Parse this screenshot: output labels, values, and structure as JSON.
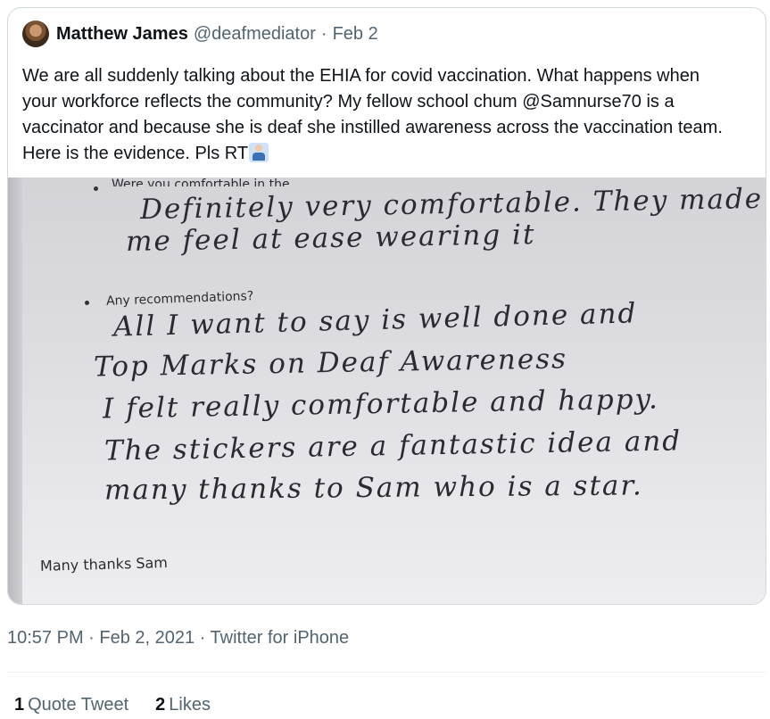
{
  "tweet": {
    "author_name": "Matthew James",
    "handle": "@deafmediator",
    "separator": "·",
    "date": "Feb 2",
    "text": "We are all suddenly talking about the EHIA for covid vaccination. What happens when your workforce reflects the community? My fellow school chum @Samnurse70 is a vaccinator and because she is deaf she instilled awareness across the vaccination team. Here is the evidence. Pls RT",
    "emoji": "man-gesturing-emoji"
  },
  "photo": {
    "printed_question_1": "Were you comfortable in the",
    "answer_1": [
      "Definitely very comfortable. They made",
      "me feel at ease wearing it"
    ],
    "printed_question_2": "Any recommendations?",
    "answer_2": [
      "All I want to say is well done and",
      "Top Marks on Deaf Awareness",
      "I felt really comfortable and happy.",
      "The stickers are a fantastic idea and",
      "many thanks to Sam who is a star."
    ],
    "signoff": "Many thanks Sam"
  },
  "footer": {
    "timestamp": "10:57 PM · Feb 2, 2021 · Twitter for iPhone"
  },
  "stats": {
    "quote_count": "1",
    "quote_label": "Quote Tweet",
    "like_count": "2",
    "like_label": "Likes"
  }
}
